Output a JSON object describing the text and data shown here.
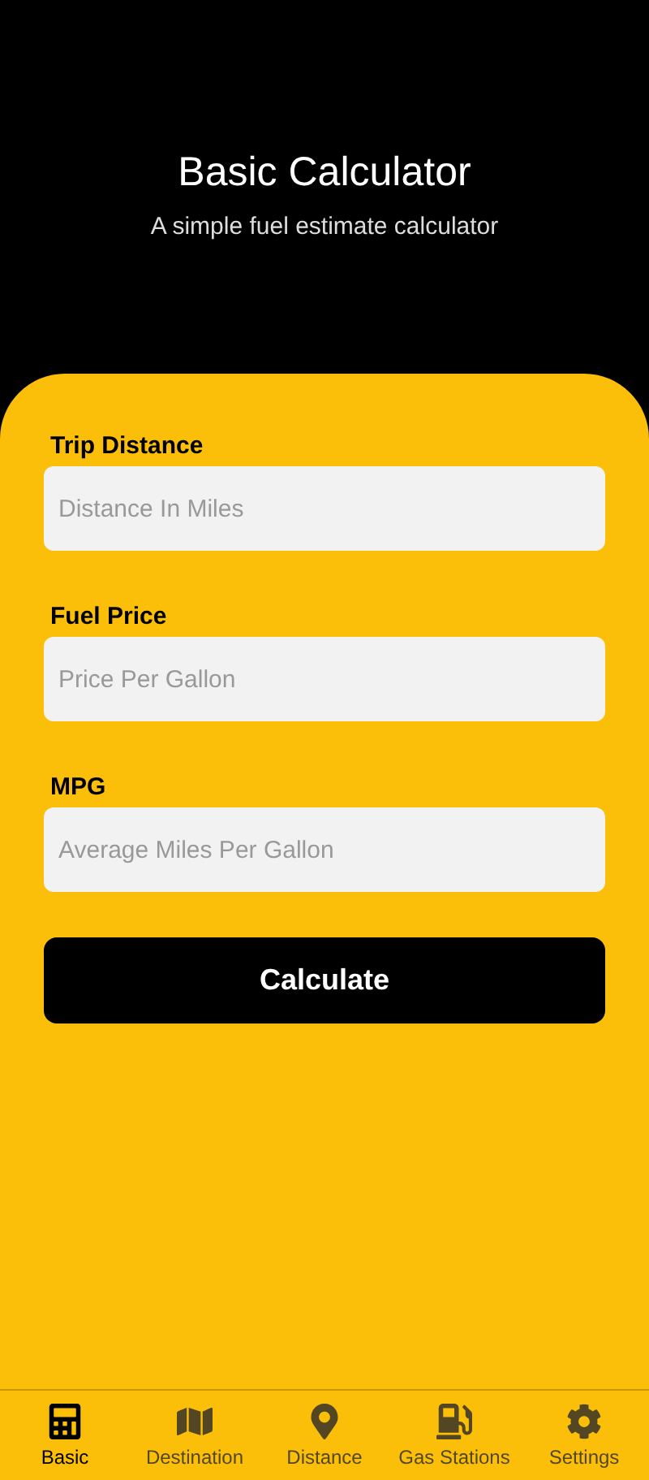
{
  "header": {
    "title": "Basic Calculator",
    "subtitle": "A simple fuel estimate calculator"
  },
  "fields": [
    {
      "label": "Trip Distance",
      "placeholder": "Distance In Miles"
    },
    {
      "label": "Fuel Price",
      "placeholder": "Price Per Gallon"
    },
    {
      "label": "MPG",
      "placeholder": "Average Miles Per Gallon"
    }
  ],
  "button": "Calculate",
  "tabs": [
    {
      "kind": "calculator",
      "label": "Basic",
      "selected": true
    },
    {
      "kind": "map",
      "label": "Destination",
      "selected": false
    },
    {
      "kind": "pin",
      "label": "Distance",
      "selected": false
    },
    {
      "kind": "fuel",
      "label": "Gas Stations",
      "selected": false
    },
    {
      "kind": "settings",
      "label": "Settings",
      "selected": false
    }
  ]
}
